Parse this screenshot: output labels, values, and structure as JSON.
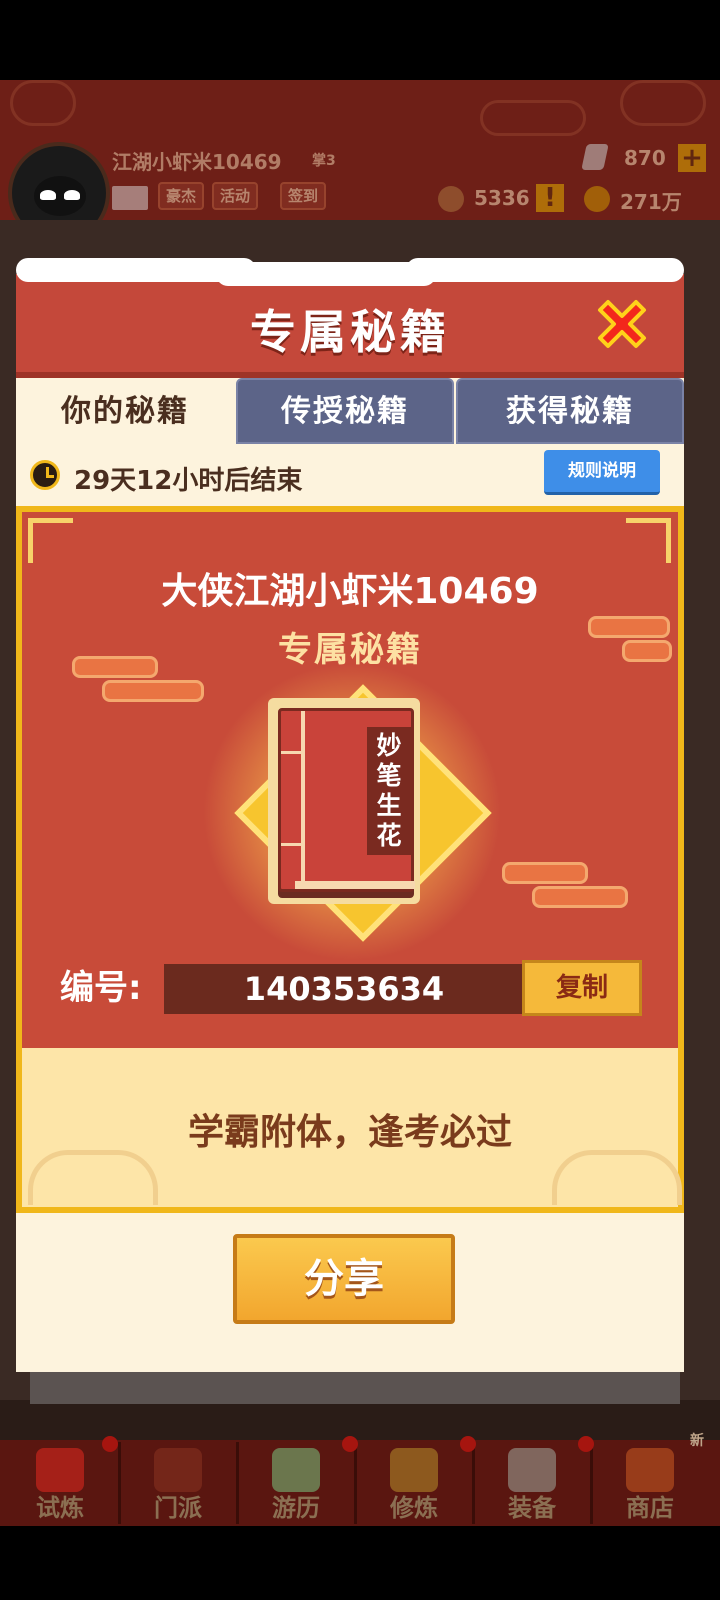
{
  "hud": {
    "player_name": "江湖小虾米10469",
    "player_level": "掌3",
    "chips": [
      "豪杰",
      "活动",
      "签到"
    ],
    "gems": "870",
    "token_count": "5336",
    "coins": "271万",
    "alert": "!",
    "plus": "+"
  },
  "modal": {
    "title": "专属秘籍",
    "tabs": [
      "你的秘籍",
      "传授秘籍",
      "获得秘籍"
    ],
    "active_tab": 0,
    "timer_text": "29天12小时后结束",
    "rules_label": "规则说明",
    "card_heading": "大侠江湖小虾米10469",
    "card_subheading": "专属秘籍",
    "book_title": "妙笔生花",
    "id_label": "编号:",
    "id_value": "140353634",
    "copy_label": "复制",
    "motto": "学霸附体，逢考必过",
    "share_label": "分享"
  },
  "bottom_nav": {
    "items": [
      {
        "label": "试炼",
        "icon": "trial-icon"
      },
      {
        "label": "门派",
        "icon": "sect-icon"
      },
      {
        "label": "游历",
        "icon": "travel-icon"
      },
      {
        "label": "修炼",
        "icon": "cultivate-icon"
      },
      {
        "label": "装备",
        "icon": "equipment-icon"
      },
      {
        "label": "商店",
        "icon": "shop-icon"
      }
    ],
    "new_badge": "新"
  },
  "colors": {
    "header_red": "#c4483a",
    "gold": "#f0b71a",
    "cream": "#fdf3dd",
    "tab_inactive": "#5c6488",
    "rules_blue": "#3e8ee8"
  }
}
